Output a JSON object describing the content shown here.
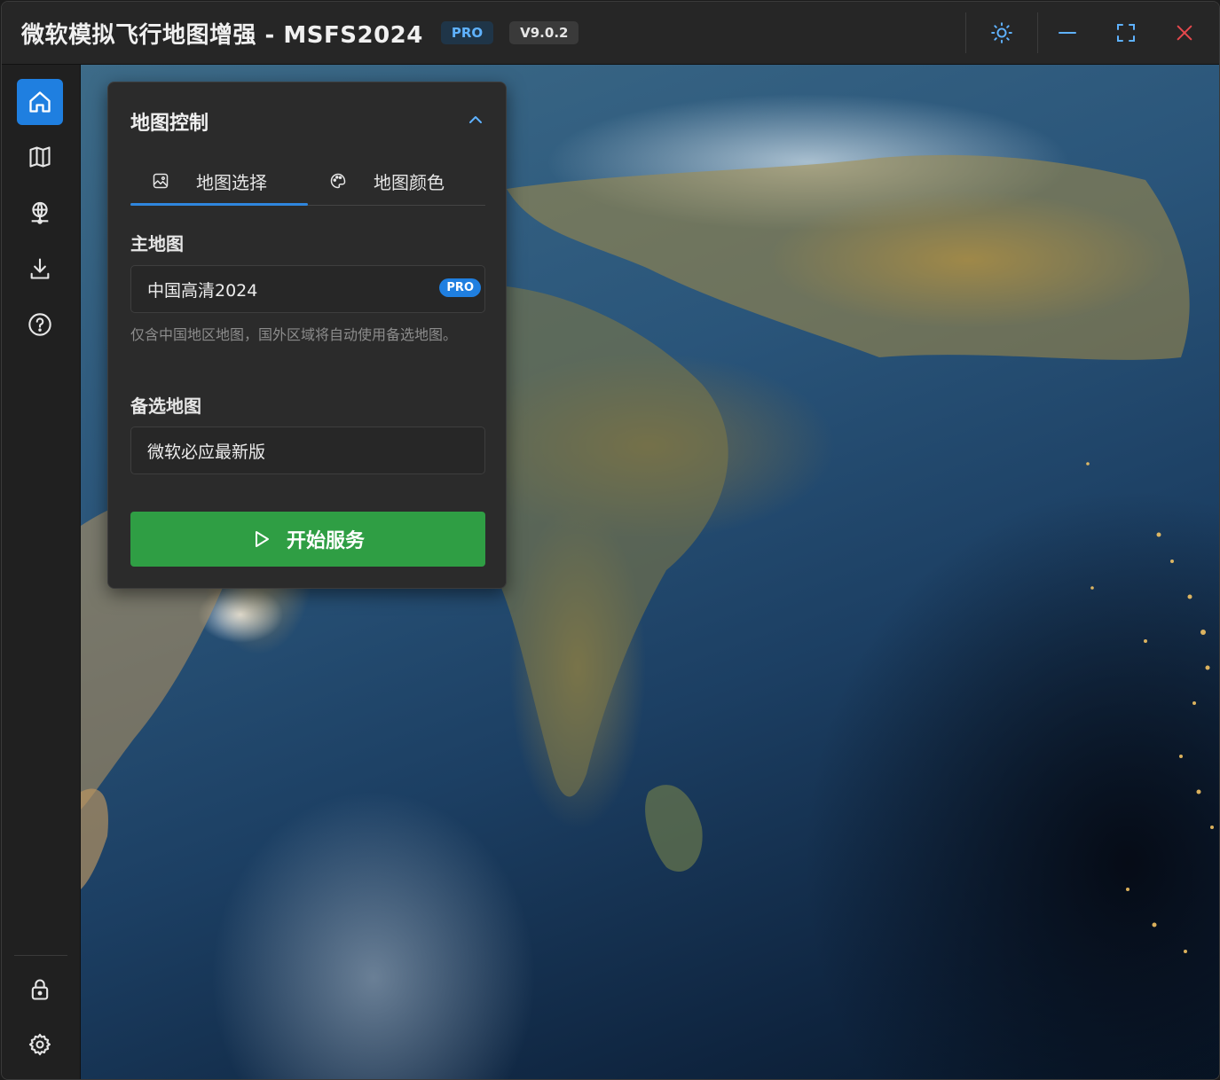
{
  "titlebar": {
    "title": "微软模拟飞行地图增强 - MSFS2024",
    "pro_badge": "PRO",
    "version": "V9.0.2",
    "buttons": [
      "theme-toggle",
      "minimize",
      "maximize",
      "close"
    ]
  },
  "sidebar": {
    "items": [
      {
        "icon": "home-icon",
        "active": true
      },
      {
        "icon": "map-icon",
        "active": false
      },
      {
        "icon": "globe-pin-icon",
        "active": false
      },
      {
        "icon": "download-icon",
        "active": false
      },
      {
        "icon": "help-icon",
        "active": false
      }
    ],
    "bottom": [
      {
        "icon": "lock-icon"
      },
      {
        "icon": "gear-icon"
      }
    ]
  },
  "panel": {
    "title": "地图控制",
    "tabs": [
      {
        "label": "地图选择",
        "icon": "image-icon",
        "active": true
      },
      {
        "label": "地图颜色",
        "icon": "palette-icon",
        "active": false
      }
    ],
    "primary_map": {
      "label": "主地图",
      "value": "中国高清2024",
      "badge": "PRO",
      "hint": "仅含中国地区地图，国外区域将自动使用备选地图。"
    },
    "backup_map": {
      "label": "备选地图",
      "value": "微软必应最新版"
    },
    "start_button": "开始服务"
  },
  "colors": {
    "accent": "#1f7fe0",
    "start": "#2f9e44",
    "close": "#e5484d"
  }
}
